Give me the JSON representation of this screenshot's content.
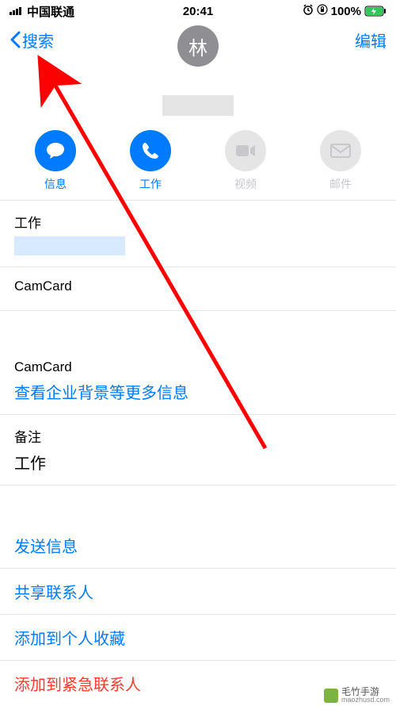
{
  "status": {
    "carrier": "中国联通",
    "time": "20:41",
    "battery": "100%"
  },
  "nav": {
    "back_label": "搜索",
    "edit_label": "编辑"
  },
  "avatar_initial": "林",
  "actions": {
    "message": "信息",
    "call": "工作",
    "video": "视频",
    "mail": "邮件"
  },
  "sections": {
    "phone_label": "工作",
    "camcard1_label": "CamCard",
    "camcard2_label": "CamCard",
    "camcard2_link": "查看企业背景等更多信息",
    "notes_label": "备注",
    "notes_value": "工作"
  },
  "links": {
    "send_message": "发送信息",
    "share_contact": "共享联系人",
    "add_favorite": "添加到个人收藏",
    "add_emergency": "添加到紧急联系人"
  },
  "watermark": {
    "name": "毛竹手游",
    "url": "maozhusd.com"
  }
}
